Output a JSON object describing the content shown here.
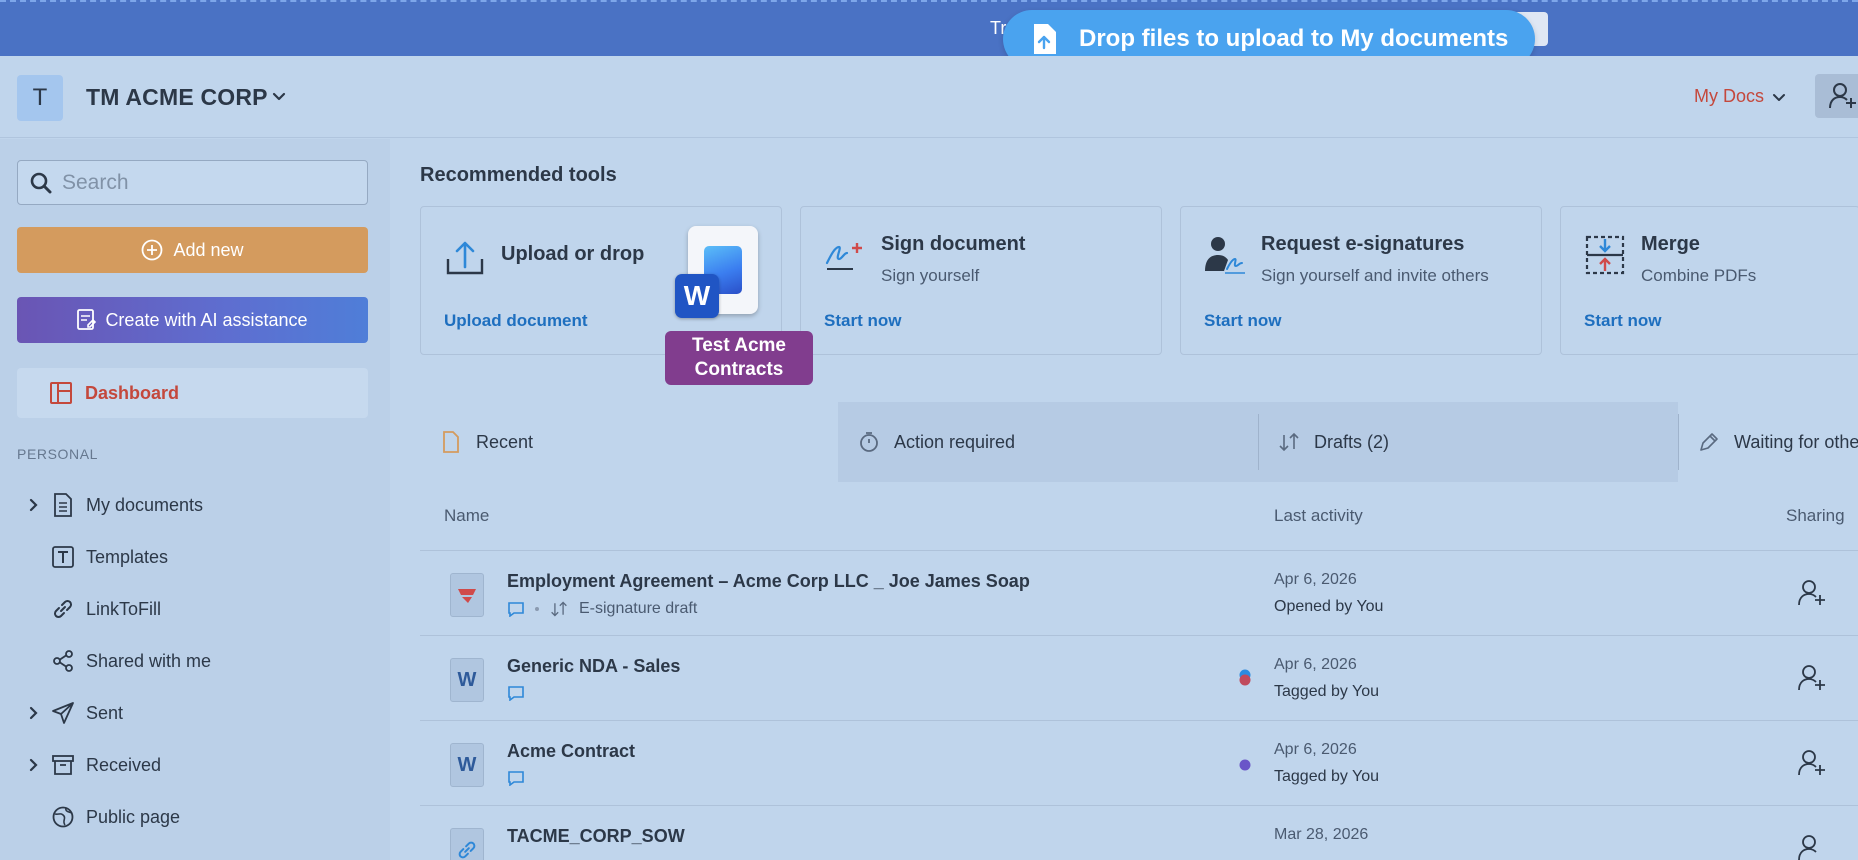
{
  "banner": {
    "behind_text": "Tr",
    "drop_message": "Drop files to upload to My documents"
  },
  "header": {
    "org_initial": "T",
    "org_name": "TM ACME CORP",
    "my_docs_label": "My Docs"
  },
  "sidebar": {
    "search_placeholder": "Search",
    "add_new_label": "Add new",
    "ai_label": "Create with AI assistance",
    "dashboard_label": "Dashboard",
    "section_personal": "PERSONAL",
    "items": [
      {
        "label": "My documents",
        "icon": "document-icon",
        "expandable": true
      },
      {
        "label": "Templates",
        "icon": "template-icon",
        "expandable": false
      },
      {
        "label": "LinkToFill",
        "icon": "link-icon",
        "expandable": false
      },
      {
        "label": "Shared with me",
        "icon": "share-icon",
        "expandable": false
      },
      {
        "label": "Sent",
        "icon": "send-icon",
        "expandable": true
      },
      {
        "label": "Received",
        "icon": "inbox-icon",
        "expandable": true
      },
      {
        "label": "Public page",
        "icon": "globe-icon",
        "expandable": false
      }
    ]
  },
  "main": {
    "recommended_title": "Recommended tools",
    "tools": [
      {
        "name": "Upload or drop",
        "sub": "",
        "link": "Upload document",
        "icon": "upload-icon"
      },
      {
        "name": "Sign document",
        "sub": "Sign yourself",
        "link": "Start now",
        "icon": "signature-icon"
      },
      {
        "name": "Request e-signatures",
        "sub": "Sign yourself and invite others",
        "link": "Start now",
        "icon": "request-signature-icon"
      },
      {
        "name": "Merge",
        "sub": "Combine PDFs",
        "link": "Start now",
        "icon": "merge-icon"
      }
    ],
    "dragged_file": {
      "badge": "W",
      "name_line1": "Test Acme",
      "name_line2": "Contracts"
    },
    "tabs": [
      {
        "label": "Recent",
        "icon": "file-icon"
      },
      {
        "label": "Action required",
        "icon": "timer-icon"
      },
      {
        "label": "Drafts (2)",
        "icon": "sort-icon"
      },
      {
        "label": "Waiting for othe",
        "icon": "pen-icon"
      }
    ],
    "columns": {
      "name": "Name",
      "activity": "Last activity",
      "sharing": "Sharing"
    },
    "rows": [
      {
        "name": "Employment Agreement – Acme Corp LLC _ Joe James Soap",
        "type": "pdf",
        "status": "E-signature draft",
        "date": "Apr 6, 2026",
        "activity": "Opened by You",
        "tags": []
      },
      {
        "name": "Generic NDA - Sales",
        "type": "word",
        "status": "",
        "date": "Apr 6, 2026",
        "activity": "Tagged by You",
        "tags": [
          "#2b8be0",
          "#c04a5c"
        ]
      },
      {
        "name": "Acme Contract",
        "type": "word",
        "status": "",
        "date": "Apr 6, 2026",
        "activity": "Tagged by You",
        "tags": [
          "#6a55c8"
        ]
      },
      {
        "name": "TACME_CORP_SOW",
        "type": "link",
        "status": "",
        "date": "Mar 28, 2026",
        "activity": "",
        "tags": []
      }
    ]
  },
  "colors": {
    "accent_red": "#c4483c",
    "link_blue": "#1e6fbf",
    "add_new_orange": "#d49b5e",
    "drop_pill": "#4aa3ef"
  }
}
